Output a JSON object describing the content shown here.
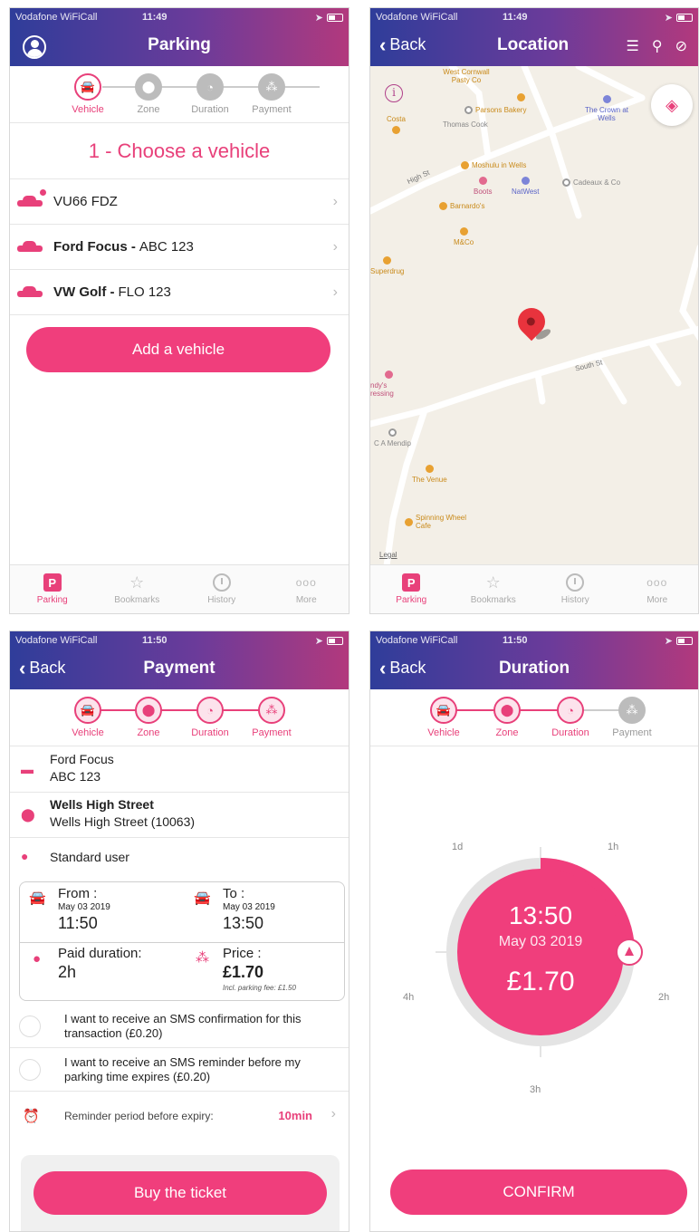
{
  "status": {
    "carrier": "Vodafone WiFiCall",
    "time_p1": "11:49",
    "time_p2": "11:49",
    "time_p3": "11:50",
    "time_p4": "11:50"
  },
  "steps": {
    "vehicle": "Vehicle",
    "zone": "Zone",
    "duration": "Duration",
    "payment": "Payment"
  },
  "tabs": {
    "parking": "Parking",
    "bookmarks": "Bookmarks",
    "history": "History",
    "more": "More",
    "p": "P",
    "more_glyph": "ooo"
  },
  "back": "Back",
  "parking": {
    "title": "Parking",
    "choose": "1 - Choose a vehicle",
    "vehicles": [
      {
        "name": "",
        "plate": "VU66 FDZ"
      },
      {
        "name": "Ford Focus -",
        "plate": "ABC 123"
      },
      {
        "name": "VW Golf -",
        "plate": "FLO 123"
      }
    ],
    "add_vehicle": "Add a vehicle"
  },
  "location": {
    "title": "Location",
    "pois": {
      "west_cornwall": "West Cornwall Pasty Co",
      "parsons": "Parsons Bakery",
      "crown": "The Crown at Wells",
      "costa": "Costa",
      "thomas_cook": "Thomas Cook",
      "moshulu": "Moshulu in Wells",
      "boots": "Boots",
      "natwest": "NatWest",
      "cadeaux": "Cadeaux & Co",
      "barnardos": "Barnardo's",
      "mco": "M&Co",
      "superdrug": "Superdrug",
      "mendip": "C A Mendip",
      "venue": "The Venue",
      "spinning": "Spinning Wheel Cafe",
      "dressing": "ndy's ressing"
    },
    "streets": {
      "high_st": "High St",
      "south_st": "South St",
      "st": "St"
    },
    "legal": "Legal",
    "info": "i"
  },
  "payment": {
    "title": "Payment",
    "vehicle_name": "Ford Focus",
    "vehicle_plate": "ABC 123",
    "zone_name": "Wells High Street",
    "zone_detail": "Wells High Street (10063)",
    "user_type": "Standard user",
    "from_label": "From :",
    "from_date": "May 03 2019",
    "from_time": "11:50",
    "to_label": "To :",
    "to_date": "May 03 2019",
    "to_time": "13:50",
    "paid_label": "Paid duration:",
    "paid_value": "2h",
    "price_label": "Price :",
    "price_value": "£1.70",
    "fee_note": "Incl. parking fee: £1.50",
    "sms_confirm": "I want to receive an SMS confirmation for this transaction (£0.20)",
    "sms_reminder": "I want to receive an SMS reminder before my parking time expires (£0.20)",
    "reminder_label": "Reminder period before expiry:",
    "reminder_value": "10min",
    "buy": "Buy the ticket"
  },
  "duration": {
    "title": "Duration",
    "time": "13:50",
    "date": "May 03 2019",
    "price": "£1.70",
    "labels": {
      "d1": "1d",
      "h1": "1h",
      "h2": "2h",
      "h3": "3h",
      "h4": "4h"
    },
    "confirm": "CONFIRM",
    "selected_fraction": 0.25
  },
  "colors": {
    "accent": "#e8407a",
    "header_start": "#2f3d9a",
    "header_end": "#b2397d"
  }
}
